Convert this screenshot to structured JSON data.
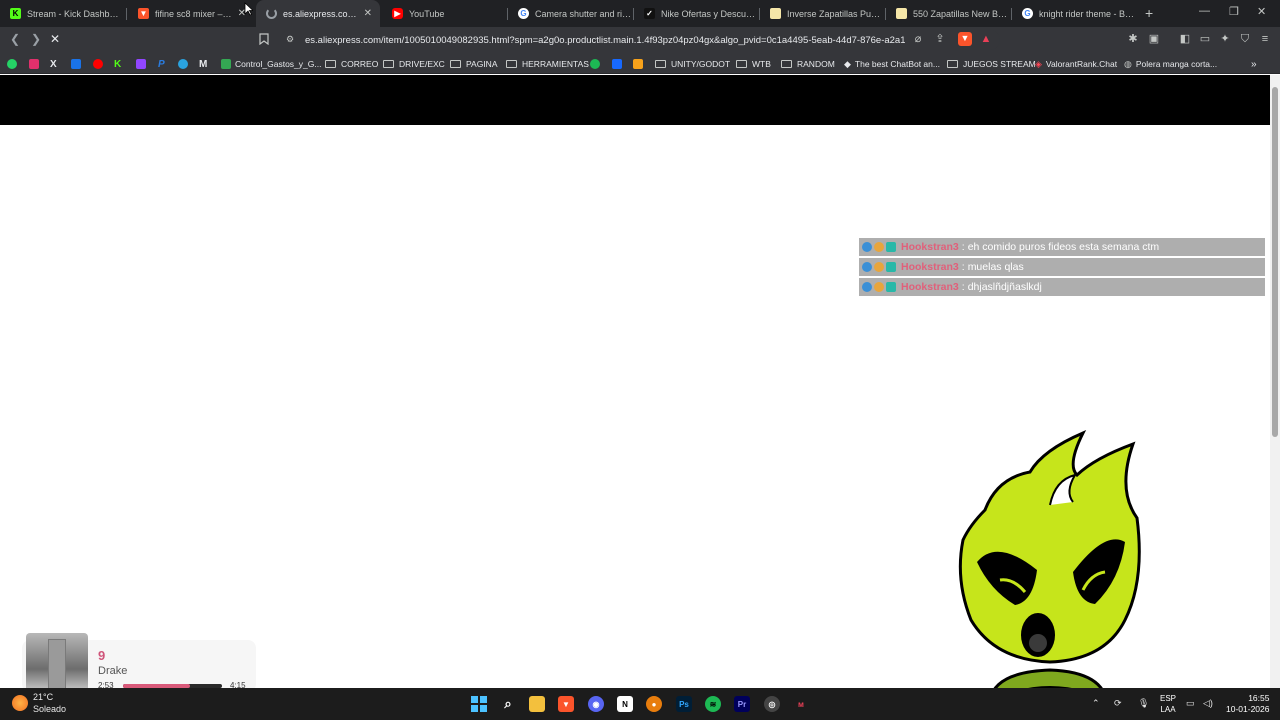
{
  "tabs": [
    {
      "title": "Stream - Kick Dashboard",
      "favicon": "kick-icon",
      "color": "#53fc18",
      "active": false
    },
    {
      "title": "fifine sc8 mixer – Com",
      "favicon": "brave-icon",
      "color": "#fb542b",
      "active": false
    },
    {
      "title": "es.aliexpress.com/item",
      "favicon": "loading-icon",
      "color": "#9aa0a6",
      "active": true
    },
    {
      "title": "YouTube",
      "favicon": "youtube-icon",
      "color": "#ff0000",
      "active": false
    },
    {
      "title": "Camera shutter and riser",
      "favicon": "google-icon",
      "color": "#4285f4",
      "active": false
    },
    {
      "title": "Nike Ofertas y Descuentos",
      "favicon": "nike-icon",
      "color": "#111111",
      "active": false
    },
    {
      "title": "Inverse Zapatillas Puma Ur",
      "favicon": "store-icon",
      "color": "#f5e6a8",
      "active": false
    },
    {
      "title": "550 Zapatillas New Balanc",
      "favicon": "store-icon",
      "color": "#f5e6a8",
      "active": false
    },
    {
      "title": "knight rider theme - Busca",
      "favicon": "google-icon",
      "color": "#4285f4",
      "active": false
    }
  ],
  "address": {
    "url": "es.aliexpress.com/item/1005010049082935.html?spm=a2g0o.productlist.main.1.4f93pz04pz04gx&algo_pvid=0c1a4495-5eab-44d7-876e-a2a1e..."
  },
  "bookmarks": [
    {
      "label": "",
      "icon": "whatsapp-icon",
      "color": "#25d366"
    },
    {
      "label": "",
      "icon": "instagram-icon",
      "color": "#e1306c"
    },
    {
      "label": "",
      "icon": "x-icon",
      "color": "#e8eaed"
    },
    {
      "label": "",
      "icon": "folder-blue-icon",
      "color": "#1a73e8"
    },
    {
      "label": "",
      "icon": "youtube-icon",
      "color": "#ff0000"
    },
    {
      "label": "",
      "icon": "kick-icon",
      "color": "#53fc18"
    },
    {
      "label": "",
      "icon": "twitch-icon",
      "color": "#9146ff"
    },
    {
      "label": "",
      "icon": "paypal-icon",
      "color": "#2a7de1"
    },
    {
      "label": "",
      "icon": "telegram-icon",
      "color": "#2aa3df"
    },
    {
      "label": "",
      "icon": "gmail-icon",
      "color": "#e8eaed"
    },
    {
      "label": "Control_Gastos_y_G...",
      "icon": "sheets-icon",
      "color": "#34a853"
    },
    {
      "label": "CORREO",
      "icon": "folder-icon",
      "color": ""
    },
    {
      "label": "DRIVE/EXC",
      "icon": "folder-icon",
      "color": ""
    },
    {
      "label": "PAGINA",
      "icon": "folder-icon",
      "color": ""
    },
    {
      "label": "HERRAMIENTAS",
      "icon": "folder-icon",
      "color": ""
    },
    {
      "label": "",
      "icon": "spotify-icon",
      "color": "#1db954"
    },
    {
      "label": "",
      "icon": "behance-icon",
      "color": "#1769ff"
    },
    {
      "label": "",
      "icon": "bag-icon",
      "color": "#f7a21b"
    },
    {
      "label": "UNITY/GODOT",
      "icon": "folder-icon",
      "color": ""
    },
    {
      "label": "WTB",
      "icon": "folder-icon",
      "color": ""
    },
    {
      "label": "RANDOM",
      "icon": "folder-icon",
      "color": ""
    },
    {
      "label": "The best ChatBot an...",
      "icon": "diamond-icon",
      "color": "#e8eaed"
    },
    {
      "label": "JUEGOS STREAM",
      "icon": "folder-icon",
      "color": ""
    },
    {
      "label": "ValorantRank.Chat",
      "icon": "valorant-icon",
      "color": "#ff4655"
    },
    {
      "label": "Polera manga corta...",
      "icon": "globe-icon",
      "color": "#c4c7c5"
    }
  ],
  "chat": {
    "messages": [
      {
        "user": "Hookstran3",
        "separator": ":",
        "text": "eh comido puros fideos esta semana ctm"
      },
      {
        "user": "Hookstran3",
        "separator": ":",
        "text": "muelas qlas"
      },
      {
        "user": "Hookstran3",
        "separator": ":",
        "text": "dhjaslñdjñaslkdj"
      }
    ]
  },
  "music": {
    "song": "9",
    "artist": "Drake",
    "current_time": "2:53",
    "total_time": "4:15",
    "progress": 0.68
  },
  "taskbar": {
    "weather_line1": "21°C",
    "weather_line2": "Soleado",
    "lang_line1": "ESP",
    "lang_line2": "LAA",
    "time": "16:55",
    "date": "10-01-2026"
  }
}
